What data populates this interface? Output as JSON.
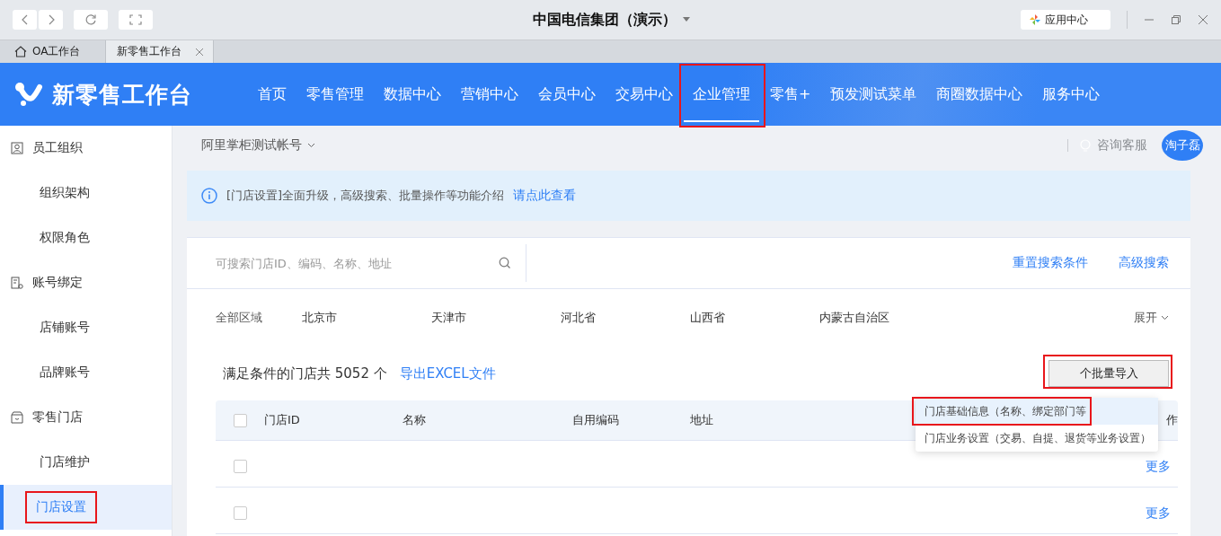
{
  "window": {
    "title": "中国电信集团（演示）",
    "app_center": "应用中心"
  },
  "tabs": [
    {
      "label": "OA工作台",
      "selected": false,
      "kind": "home"
    },
    {
      "label": "新零售工作台",
      "selected": true,
      "kind": "closable"
    }
  ],
  "header": {
    "logo": "新零售工作台",
    "nav": [
      {
        "label": "首页",
        "selected": false,
        "highlighted": false
      },
      {
        "label": "零售管理",
        "selected": false,
        "highlighted": false
      },
      {
        "label": "数据中心",
        "selected": false,
        "highlighted": false
      },
      {
        "label": "营销中心",
        "selected": false,
        "highlighted": false
      },
      {
        "label": "会员中心",
        "selected": false,
        "highlighted": false
      },
      {
        "label": "交易中心",
        "selected": false,
        "highlighted": false
      },
      {
        "label": "企业管理",
        "selected": true,
        "highlighted": true
      },
      {
        "label": "零售+",
        "selected": false,
        "highlighted": false
      },
      {
        "label": "预发测试菜单",
        "selected": false,
        "highlighted": false
      },
      {
        "label": "商圈数据中心",
        "selected": false,
        "highlighted": false
      },
      {
        "label": "服务中心",
        "selected": false,
        "highlighted": false
      }
    ]
  },
  "sidebar": {
    "groups": [
      {
        "label": "员工组织",
        "kind": "people",
        "children": [
          {
            "label": "组织架构",
            "selected": false,
            "highlighted": false
          },
          {
            "label": "权限角色",
            "selected": false,
            "highlighted": false
          }
        ]
      },
      {
        "label": "账号绑定",
        "kind": "account",
        "children": [
          {
            "label": "店铺账号",
            "selected": false,
            "highlighted": false
          },
          {
            "label": "品牌账号",
            "selected": false,
            "highlighted": false
          }
        ]
      },
      {
        "label": "零售门店",
        "kind": "store",
        "children": [
          {
            "label": "门店维护",
            "selected": false,
            "highlighted": false
          },
          {
            "label": "门店设置",
            "selected": true,
            "highlighted": true
          }
        ]
      }
    ]
  },
  "topbar": {
    "account": "阿里掌柜测试帐号",
    "service": "咨询客服",
    "user": "淘子磊"
  },
  "notice": {
    "text": "[门店设置]全面升级，高级搜索、批量操作等功能介绍",
    "link": "请点此查看"
  },
  "search": {
    "placeholder": "可搜索门店ID、编码、名称、地址",
    "reset": "重置搜索条件",
    "advanced": "高级搜索"
  },
  "regions": {
    "label": "全部区域",
    "items": [
      "北京市",
      "天津市",
      "河北省",
      "山西省",
      "内蒙古自治区"
    ],
    "expand": "展开"
  },
  "result": {
    "summary": "满足条件的门店共 5052 个",
    "export": "导出EXCEL文件",
    "import_button": "个批量导入",
    "import_highlighted": true
  },
  "import_menu": [
    {
      "label": "门店基础信息（名称、绑定部门等",
      "highlighted": true
    },
    {
      "label": "门店业务设置（交易、自提、退货等业务设置）",
      "highlighted": false
    }
  ],
  "table": {
    "select_all": false,
    "columns": [
      "门店ID",
      "名称",
      "自用编码",
      "地址",
      "作"
    ],
    "rows": [
      {
        "checked": false,
        "action": "更多"
      },
      {
        "checked": false,
        "action": "更多"
      }
    ]
  }
}
